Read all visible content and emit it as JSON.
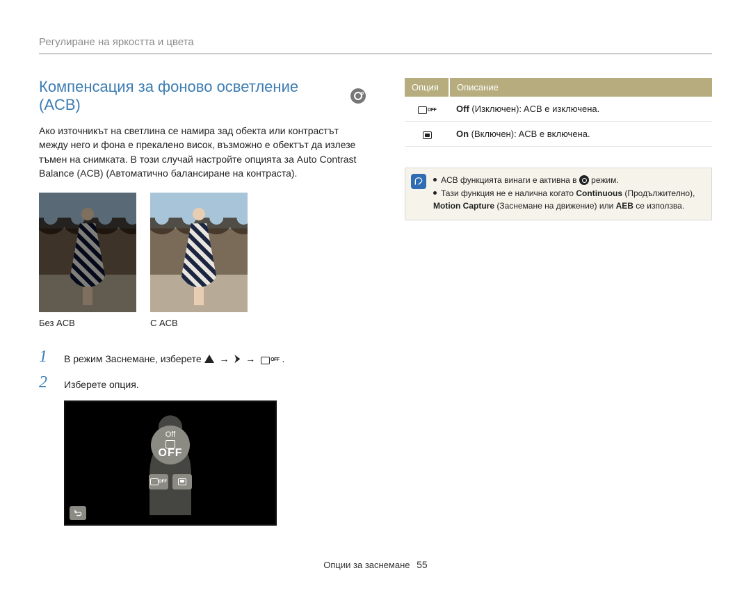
{
  "running_head": "Регулиране на яркостта и цвета",
  "section_title": "Компенсация за фоново осветление (ACB)",
  "intro_text": "Ако източникът на светлина се намира зад обекта или контрастът между него и фона е прекалено висок, възможно е обектът да излезе тъмен на снимката. В този случай настройте опцията за Auto Contrast Balance (ACB) (Автоматично балансиране на контраста).",
  "captions": {
    "without": "Без ACB",
    "with": "С ACB"
  },
  "steps": {
    "s1_prefix": "В режим Заснемане, изберете ",
    "s1_suffix": ".",
    "arrow": "→",
    "s2": "Изберете опция."
  },
  "screen": {
    "label_off": "Off",
    "big_off": "OFF"
  },
  "table": {
    "head_option": "Опция",
    "head_desc": "Описание",
    "rows": [
      {
        "icon": "acb-off",
        "bold": "Off",
        "paren": " (Изключен): ACB е изключена."
      },
      {
        "icon": "acb-on",
        "bold": "On",
        "paren": " (Включен): ACB е включена."
      }
    ]
  },
  "notes": {
    "n1_a": "ACB функцията винаги е активна в ",
    "n1_b": " режим.",
    "n2_a": "Тази функция не е налична когато ",
    "n2_b": "Continuous",
    "n2_c": " (Продължително), ",
    "n2_d": "Motion Capture",
    "n2_e": " (Заснемане на движение) или ",
    "n2_f": "AEB",
    "n2_g": " се използва."
  },
  "footer": {
    "section": "Опции за заснемане",
    "page": "55"
  }
}
